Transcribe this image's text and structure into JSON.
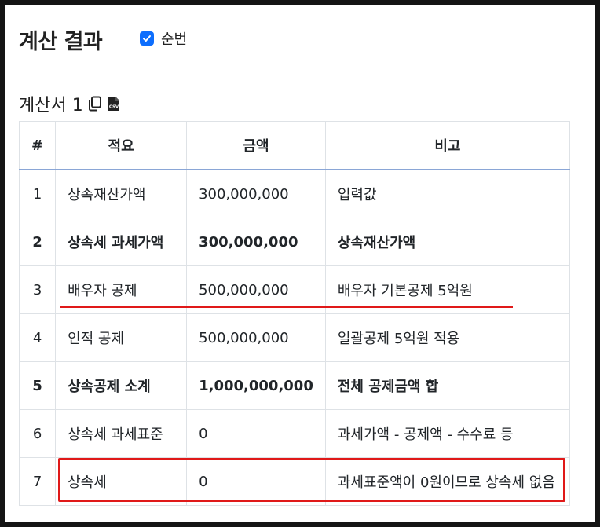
{
  "header": {
    "title": "계산 결과",
    "checkbox_label": "순번",
    "checkbox_checked": true
  },
  "section": {
    "title": "계산서 1",
    "copy_icon": "copy-icon",
    "csv_icon": "csv-file-icon"
  },
  "table": {
    "columns": [
      "#",
      "적요",
      "금액",
      "비고"
    ],
    "rows": [
      {
        "idx": "1",
        "item": "상속재산가액",
        "amount": "300,000,000",
        "note": "입력값",
        "bold": false
      },
      {
        "idx": "2",
        "item": "상속세 과세가액",
        "amount": "300,000,000",
        "note": "상속재산가액",
        "bold": true
      },
      {
        "idx": "3",
        "item": "배우자 공제",
        "amount": "500,000,000",
        "note": "배우자 기본공제 5억원",
        "bold": false
      },
      {
        "idx": "4",
        "item": "인적 공제",
        "amount": "500,000,000",
        "note": "일괄공제 5억원 적용",
        "bold": false
      },
      {
        "idx": "5",
        "item": "상속공제 소계",
        "amount": "1,000,000,000",
        "note": "전체 공제금액 합",
        "bold": true
      },
      {
        "idx": "6",
        "item": "상속세 과세표준",
        "amount": "0",
        "note": "과세가액 - 공제액 - 수수료 등",
        "bold": false
      },
      {
        "idx": "7",
        "item": "상속세",
        "amount": "0",
        "note": "과세표준액이 0원이므로 상속세 없음",
        "bold": false
      }
    ]
  },
  "colors": {
    "accent": "#0d6efd",
    "annotation_red": "#e01919"
  }
}
